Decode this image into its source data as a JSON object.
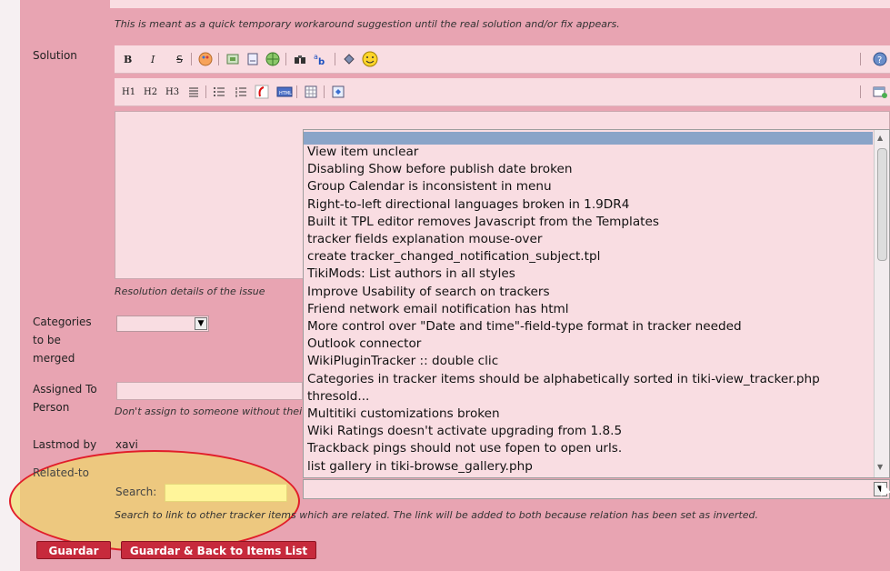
{
  "note": "This is meant as a quick temporary workaround suggestion until the real solution and/or fix appears.",
  "solution": {
    "label": "Solution",
    "toolbar1": [
      "B",
      "I",
      "S",
      "palette-icon",
      "image-icon",
      "file-icon",
      "globe-icon",
      "binoculars-icon",
      "translate-icon",
      "plugin-icon",
      "smiley-icon",
      "help-icon"
    ],
    "toolbar2": [
      "H1",
      "H2",
      "H3",
      "align-icon",
      "list-icon",
      "numlist-icon",
      "flash-icon",
      "html-icon",
      "table-icon",
      "switch-icon",
      "new-window-icon"
    ],
    "help": "Resolution details of the issue"
  },
  "categories": {
    "label_lines": [
      "Categories",
      "to be",
      "merged"
    ],
    "selected": ""
  },
  "assigned": {
    "label_lines": [
      "Assigned To",
      "Person"
    ],
    "value": "",
    "help": "Don't assign to someone without their"
  },
  "lastmod": {
    "label": "Lastmod by",
    "value": "xavi"
  },
  "related": {
    "label": "Related-to",
    "search_label": "Search:",
    "search_value": "",
    "help": "Search to link to other tracker items which are related. The link will be added to both because relation has been set as inverted."
  },
  "dropdown_items": [
    "View item unclear",
    "Disabling Show before publish date broken",
    "Group Calendar is inconsistent in menu",
    "Right-to-left directional languages broken in 1.9DR4",
    "Built it TPL editor removes Javascript from the Templates",
    "tracker fields explanation mouse-over",
    "create tracker_changed_notification_subject.tpl",
    "TikiMods: List authors in all styles",
    "Improve Usability of search on trackers",
    "Friend network email notification has html",
    "More control over \"Date and time\"-field-type format in tracker needed",
    "Outlook connector",
    "WikiPluginTracker :: double clic",
    "Categories in tracker items should be alphabetically sorted in tiki-view_tracker.php",
    "thresold...",
    "Multitiki customizations broken",
    "Wiki Ratings doesn't activate upgrading from 1.8.5",
    "Trackback pings should not use fopen to open urls.",
    "list gallery in tiki-browse_gallery.php"
  ],
  "buttons": {
    "save": "Guardar",
    "save_back": "Guardar & Back to Items List"
  },
  "colors": {
    "panel": "#e8a4b2",
    "field": "#f9dde2",
    "button": "#c72a3c",
    "highlight": "#f0dc64",
    "ellipse": "#e11d2a"
  }
}
